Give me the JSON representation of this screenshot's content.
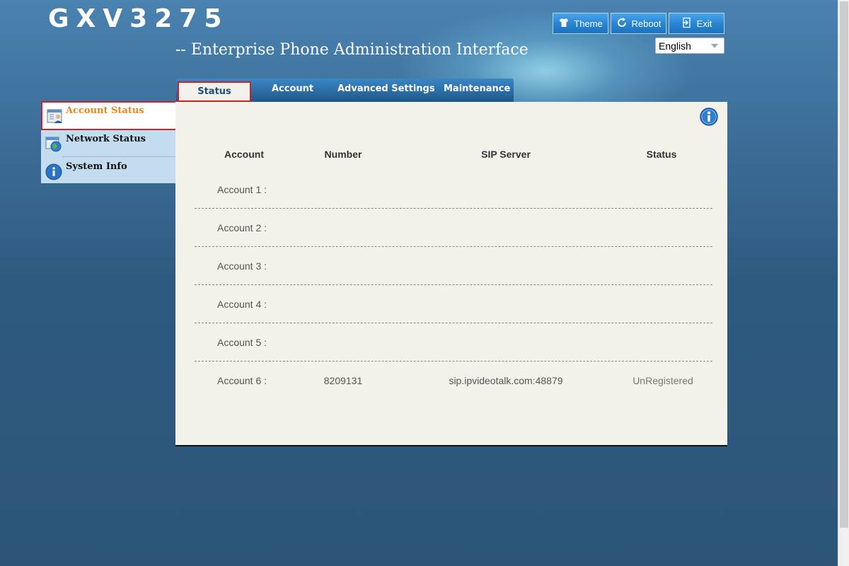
{
  "header": {
    "logo": "GXV3275",
    "subtitle": "-- Enterprise Phone Administration Interface",
    "buttons": [
      {
        "label": "Theme",
        "icon": "shirt-icon"
      },
      {
        "label": "Reboot",
        "icon": "refresh-icon"
      },
      {
        "label": "Exit",
        "icon": "exit-door-icon"
      }
    ],
    "language": {
      "selected": "English"
    }
  },
  "tabs": [
    {
      "label": "Status",
      "active": true
    },
    {
      "label": "Account"
    },
    {
      "label": "Advanced Settings"
    },
    {
      "label": "Maintenance"
    }
  ],
  "sidebar": {
    "items": [
      {
        "label": "Account Status",
        "icon": "account-card-icon",
        "active": true
      },
      {
        "label": "Network Status",
        "icon": "network-globe-icon"
      },
      {
        "label": "System Info",
        "icon": "info-circle-icon"
      }
    ]
  },
  "table": {
    "headers": [
      "Account",
      "Number",
      "SIP Server",
      "Status"
    ],
    "rows": [
      {
        "account": "Account 1 :",
        "number": "",
        "sip_server": "",
        "status": ""
      },
      {
        "account": "Account 2 :",
        "number": "",
        "sip_server": "",
        "status": ""
      },
      {
        "account": "Account 3 :",
        "number": "",
        "sip_server": "",
        "status": ""
      },
      {
        "account": "Account 4 :",
        "number": "",
        "sip_server": "",
        "status": ""
      },
      {
        "account": "Account 5 :",
        "number": "",
        "sip_server": "",
        "status": ""
      },
      {
        "account": "Account 6 :",
        "number": "8209131",
        "sip_server": "sip.ipvideotalk.com:48879",
        "status": "UnRegistered"
      }
    ]
  },
  "colors": {
    "accent_red": "#d11f2a",
    "active_sidebar_text": "#e9861d",
    "tab_bar": "#2a6aa3",
    "panel_bg": "#f2f1ea"
  }
}
